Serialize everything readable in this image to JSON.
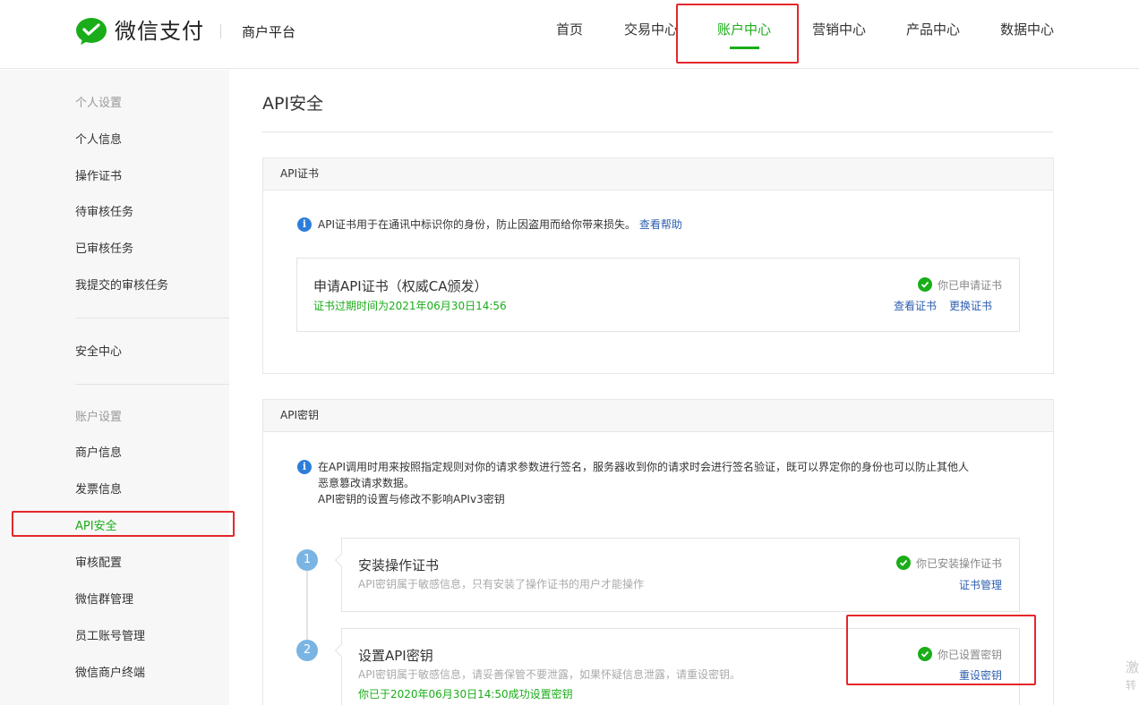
{
  "header": {
    "logo_text": "微信支付",
    "platform": "商户平台",
    "nav": [
      "首页",
      "交易中心",
      "账户中心",
      "营销中心",
      "产品中心",
      "数据中心"
    ]
  },
  "sidebar": {
    "group1": "个人设置",
    "items1": [
      "个人信息",
      "操作证书",
      "待审核任务",
      "已审核任务",
      "我提交的审核任务"
    ],
    "security": "安全中心",
    "group2": "账户设置",
    "items2": [
      "商户信息",
      "发票信息",
      "API安全",
      "审核配置",
      "微信群管理",
      "员工账号管理",
      "微信商户终端"
    ]
  },
  "main": {
    "title": "API安全",
    "cert_card": {
      "head": "API证书",
      "notice": "API证书用于在通讯中标识你的身份，防止因盗用而给你带来损失。",
      "help_link": "查看帮助",
      "item_title": "申请API证书（权威CA颁发）",
      "item_sub": "证书过期时间为2021年06月30日14:56",
      "status": "你已申请证书",
      "action1": "查看证书",
      "action2": "更换证书"
    },
    "key_card": {
      "head": "API密钥",
      "notice_line1": "在API调用时用来按照指定规则对你的请求参数进行签名，服务器收到你的请求时会进行签名验证，既可以界定你的身份也可以防止其他人",
      "notice_line2": "恶意篡改请求数据。",
      "notice_line3": "API密钥的设置与修改不影响APIv3密钥",
      "step1": {
        "num": "1",
        "title": "安装操作证书",
        "sub": "API密钥属于敏感信息，只有安装了操作证书的用户才能操作",
        "status": "你已安装操作证书",
        "action": "证书管理"
      },
      "step2": {
        "num": "2",
        "title": "设置API密钥",
        "sub": "API密钥属于敏感信息，请妥善保管不要泄露，如果怀疑信息泄露，请重设密钥。",
        "sub2": "你已于2020年06月30日14:50成功设置密钥",
        "status": "你已设置密钥",
        "action": "重设密钥"
      }
    }
  },
  "watermark": {
    "line1": "激",
    "line2": "转"
  },
  "colors": {
    "brand_green": "#1aad19",
    "link_blue": "#2d5fb0",
    "annotation_red": "#e5272b"
  }
}
